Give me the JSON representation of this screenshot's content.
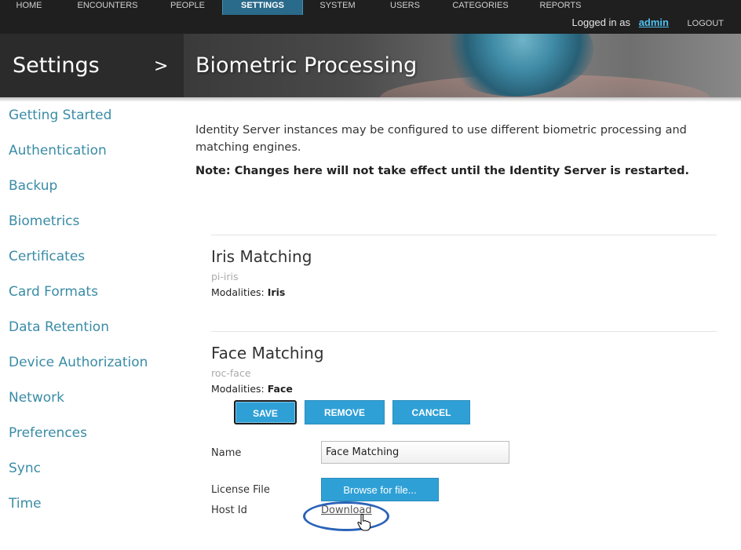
{
  "nav": {
    "items": [
      "HOME",
      "ENCOUNTERS",
      "PEOPLE",
      "SETTINGS",
      "SYSTEM",
      "USERS",
      "CATEGORIES",
      "REPORTS"
    ],
    "active": "SETTINGS",
    "logged_in_text": "Logged in as",
    "user": "admin",
    "logout": "LOGOUT"
  },
  "header": {
    "section": "Settings",
    "chevron": ">",
    "title": "Biometric Processing"
  },
  "sidebar": {
    "items": [
      "Getting Started",
      "Authentication",
      "Backup",
      "Biometrics",
      "Certificates",
      "Card Formats",
      "Data Retention",
      "Device Authorization",
      "Network",
      "Preferences",
      "Sync",
      "Time"
    ]
  },
  "content": {
    "intro": "Identity Server instances may be configured to use different biometric processing and matching engines.",
    "note": "Note: Changes here will not take effect until the Identity Server is restarted.",
    "engines": [
      {
        "title": "Iris Matching",
        "id": "pi-iris",
        "modalities_label": "Modalities:",
        "modalities": "Iris"
      },
      {
        "title": "Face Matching",
        "id": "roc-face",
        "modalities_label": "Modalities:",
        "modalities": "Face"
      }
    ],
    "buttons": {
      "save": "SAVE",
      "remove": "REMOVE",
      "cancel": "CANCEL"
    },
    "form": {
      "name_label": "Name",
      "name_value": "Face Matching",
      "license_label": "License File",
      "browse_label": "Browse for file...",
      "host_label": "Host Id",
      "download_label": "Download"
    }
  },
  "colors": {
    "accent": "#2fa0d6",
    "link": "#3a8ca6",
    "topbar": "#1f1f1f",
    "highlight_ring": "#2a63b8"
  }
}
